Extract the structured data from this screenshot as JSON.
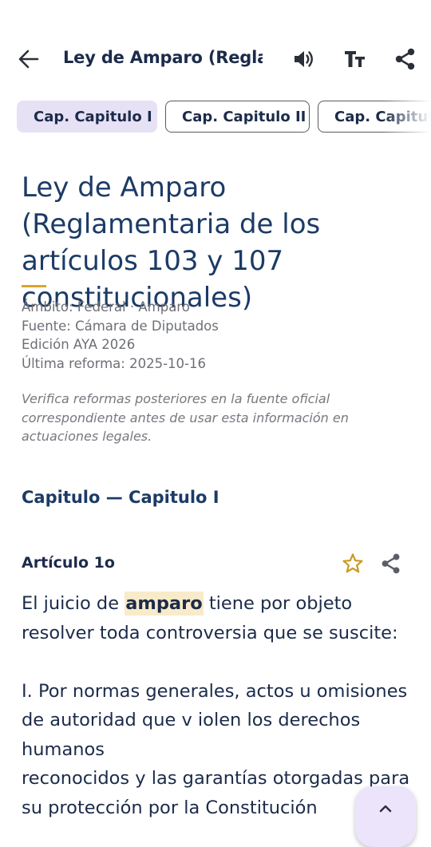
{
  "app_bar": {
    "title": "Ley de Amparo (Regla...",
    "back_icon": "arrow-back-icon",
    "actions": [
      "volume-icon",
      "text-size-icon",
      "share-icon"
    ]
  },
  "chapter_chips": [
    {
      "label": "Cap. Capitulo I",
      "selected": true
    },
    {
      "label": "Cap. Capitulo II",
      "selected": false
    },
    {
      "label": "Cap. Capitulo",
      "selected": false
    }
  ],
  "document": {
    "title": "Ley de Amparo (Reglamentaria de los artículos 103 y 107 constitucionales)",
    "meta": {
      "scope": "Ámbito: Federal · Amparo",
      "source": "Fuente: Cámara de Diputados",
      "edition": "Edición AYA 2026",
      "last_reform": "Última reforma: 2025-10-16"
    },
    "notice": "Verifica reformas posteriores en la fuente oficial correspondiente antes de usar esta información en actuaciones legales."
  },
  "chapter_heading": "Capitulo — Capitulo I",
  "article": {
    "heading": "Artículo 1o",
    "para1_before": "El juicio de ",
    "para1_highlight": "amparo",
    "para1_after": " tiene por objeto resolver toda controversia que se suscite:",
    "para2_line1": "I. Por normas generales, actos u omisiones de autoridad que v iolen los derechos humanos",
    "para2_line2": "reconocidos y las garantías otorgadas para su protección por la Constitución"
  },
  "colors": {
    "accent": "#d9a52a",
    "primary_text": "#1c3b66",
    "chip_selected": "#e7e1f6",
    "highlight": "#f8ebc9"
  }
}
